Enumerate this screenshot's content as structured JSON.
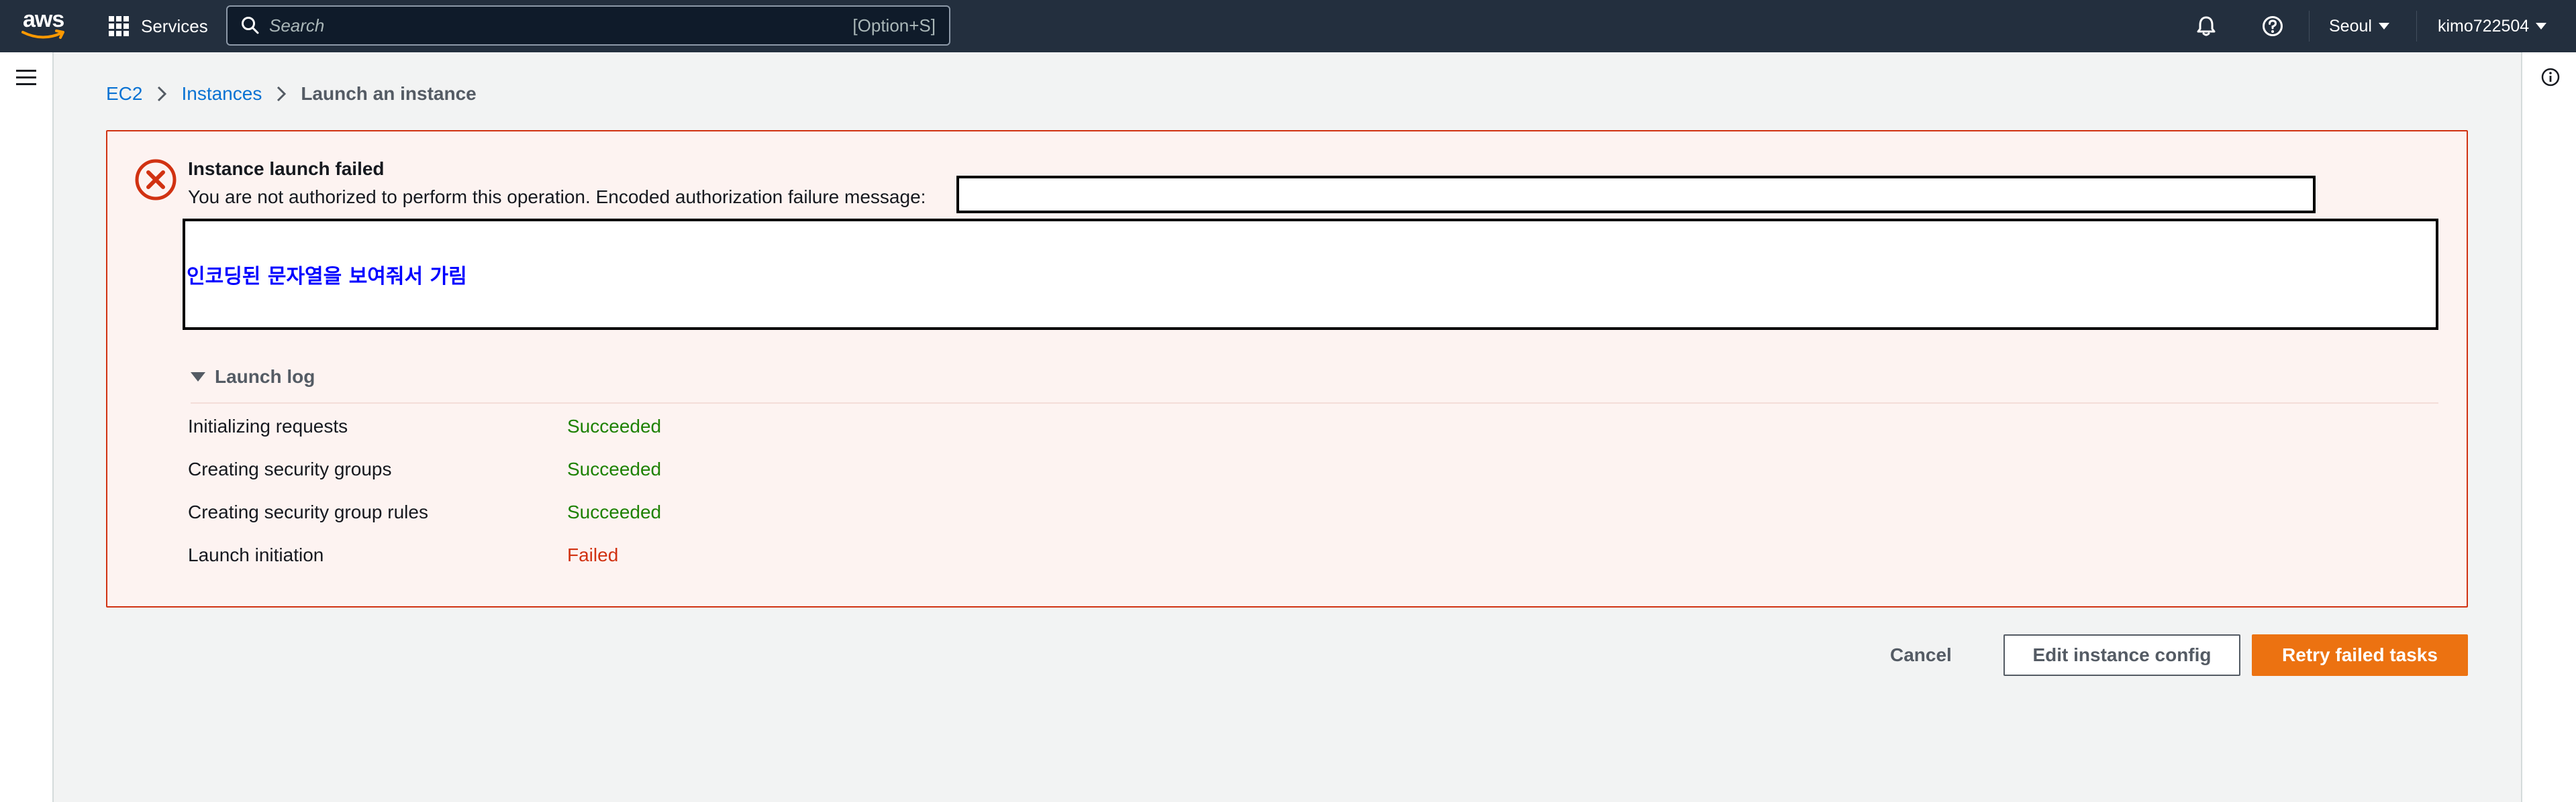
{
  "topnav": {
    "logo_text": "aws",
    "services_label": "Services",
    "search": {
      "placeholder": "Search",
      "shortcut": "[Option+S]"
    },
    "region": "Seoul",
    "account": "kimo722504",
    "icons": {
      "notifications": "bell-icon",
      "help": "question-circle-icon"
    }
  },
  "breadcrumb": [
    "EC2",
    "Instances",
    "Launch an instance"
  ],
  "alert": {
    "title": "Instance launch failed",
    "message": "You are not authorized to perform this operation. Encoded authorization failure message:",
    "redaction_note": "인코딩된 문자열을 보여줘서 가림",
    "log_title": "Launch log",
    "log": [
      {
        "step": "Initializing requests",
        "status": "Succeeded"
      },
      {
        "step": "Creating security groups",
        "status": "Succeeded"
      },
      {
        "step": "Creating security group rules",
        "status": "Succeeded"
      },
      {
        "step": "Launch initiation",
        "status": "Failed"
      }
    ]
  },
  "actions": {
    "cancel": "Cancel",
    "edit": "Edit instance config",
    "retry": "Retry failed tasks"
  },
  "colors": {
    "nav_bg": "#232f3e",
    "link": "#0972d3",
    "error": "#d13212",
    "success": "#1d8102",
    "primary": "#ec7211"
  }
}
